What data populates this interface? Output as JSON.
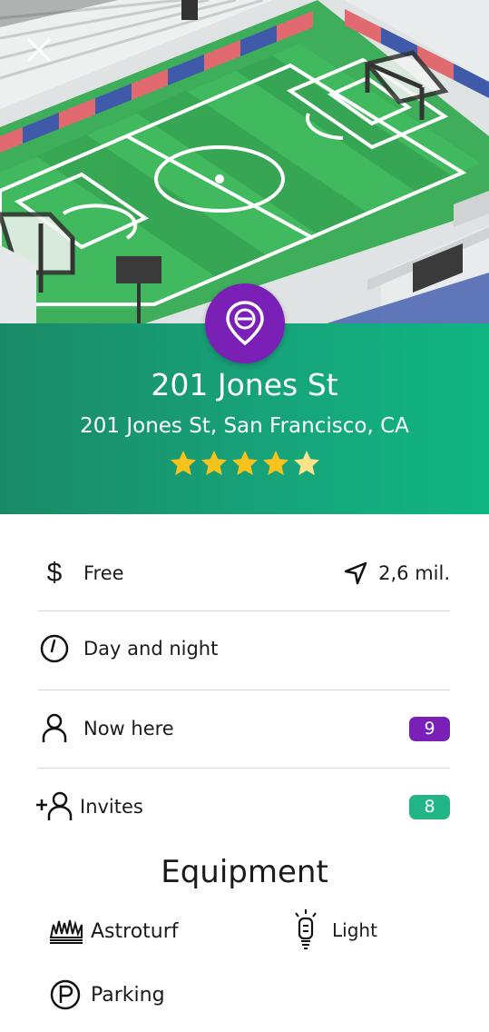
{
  "hero": {
    "scene": "isometric soccer stadium"
  },
  "place": {
    "name": "201 Jones St",
    "address": "201 Jones St, San Francisco, CA",
    "rating": 4.5,
    "stars_max": 5
  },
  "info": {
    "price": "Free",
    "distance": "2,6 mil.",
    "hours": "Day and night",
    "now_here_label": "Now here",
    "now_here_count": "9",
    "invites_label": "Invites",
    "invites_count": "8"
  },
  "equipment": {
    "title": "Equipment",
    "items": [
      {
        "label": "Astroturf",
        "icon": "grass-icon"
      },
      {
        "label": "Light",
        "icon": "lightbulb-icon"
      },
      {
        "label": "Parking",
        "icon": "parking-icon"
      }
    ]
  },
  "colors": {
    "green": "#17a37a",
    "purple": "#7a20b7",
    "invite_badge": "#22b585",
    "star": "#f7c21b"
  }
}
